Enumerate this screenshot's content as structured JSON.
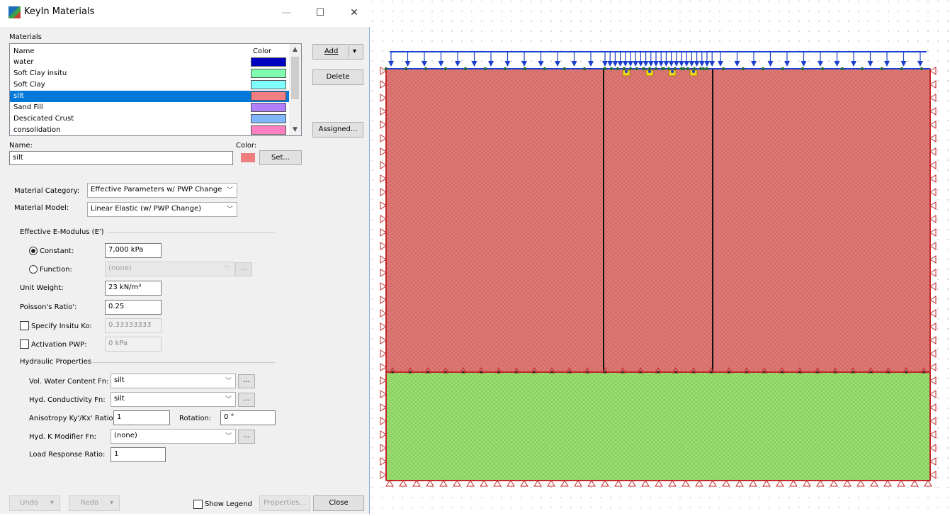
{
  "window": {
    "title": "KeyIn Materials",
    "minimize_glyph": "—",
    "maximize_glyph": "☐",
    "close_glyph": "✕"
  },
  "materials": {
    "group_label": "Materials",
    "col_name": "Name",
    "col_color": "Color",
    "rows": [
      {
        "name": "water",
        "color": "#0000c0"
      },
      {
        "name": "Soft Clay insitu",
        "color": "#80ffb0"
      },
      {
        "name": "Soft Clay",
        "color": "#80ffff"
      },
      {
        "name": "silt",
        "color": "#f08080"
      },
      {
        "name": "Sand Fill",
        "color": "#b080ff"
      },
      {
        "name": "Descicated Crust",
        "color": "#80b8ff"
      },
      {
        "name": "consolidation",
        "color": "#ff80c0"
      }
    ],
    "selected_index": 3
  },
  "buttons": {
    "add": "Add",
    "add_dropdown": "▾",
    "delete": "Delete",
    "assigned": "Assigned...",
    "set": "Set...",
    "undo": "Undo",
    "redo": "Redo",
    "properties": "Properties...",
    "close": "Close",
    "dots": "..."
  },
  "name_field": {
    "label": "Name:",
    "value": "silt"
  },
  "color_field": {
    "label": "Color:",
    "value": "#f08080"
  },
  "category": {
    "label": "Material Category:",
    "value": "Effective Parameters w/ PWP Change"
  },
  "model": {
    "label": "Material Model:",
    "value": "Linear Elastic (w/ PWP Change)"
  },
  "emodulus": {
    "group_label": "Effective E-Modulus (E')",
    "constant_label": "Constant:",
    "constant_value": "7,000 kPa",
    "function_label": "Function:",
    "function_value": "(none)"
  },
  "unit_weight": {
    "label": "Unit Weight:",
    "value": "23 kN/m³"
  },
  "poisson": {
    "label": "Poisson's Ratio':",
    "value": "0.25"
  },
  "insitu_ko": {
    "label": "Specify Insitu Ko:",
    "value": "0.33333333"
  },
  "activation_pwp": {
    "label": "Activation PWP:",
    "value": "0 kPa"
  },
  "hydraulic": {
    "group_label": "Hydraulic Properties",
    "vwc_label": "Vol. Water Content Fn:",
    "vwc_value": "silt",
    "hyd_cond_label": "Hyd. Conductivity Fn:",
    "hyd_cond_value": "silt",
    "anisotropy_label": "Anisotropy Ky'/Kx' Ratio:",
    "anisotropy_value": "1",
    "rotation_label": "Rotation:",
    "rotation_value": "0 °",
    "kmod_label": "Hyd. K Modifier Fn:",
    "kmod_value": "(none)",
    "load_response_label": "Load Response Ratio:",
    "load_response_value": "1"
  },
  "show_legend": {
    "label": "Show Legend",
    "checked": false
  },
  "model_view": {
    "upper_region_color": "#e07a76",
    "lower_region_color": "#9be070",
    "boundary_color": "#c0282a",
    "load_color": "#1a3fd0"
  }
}
